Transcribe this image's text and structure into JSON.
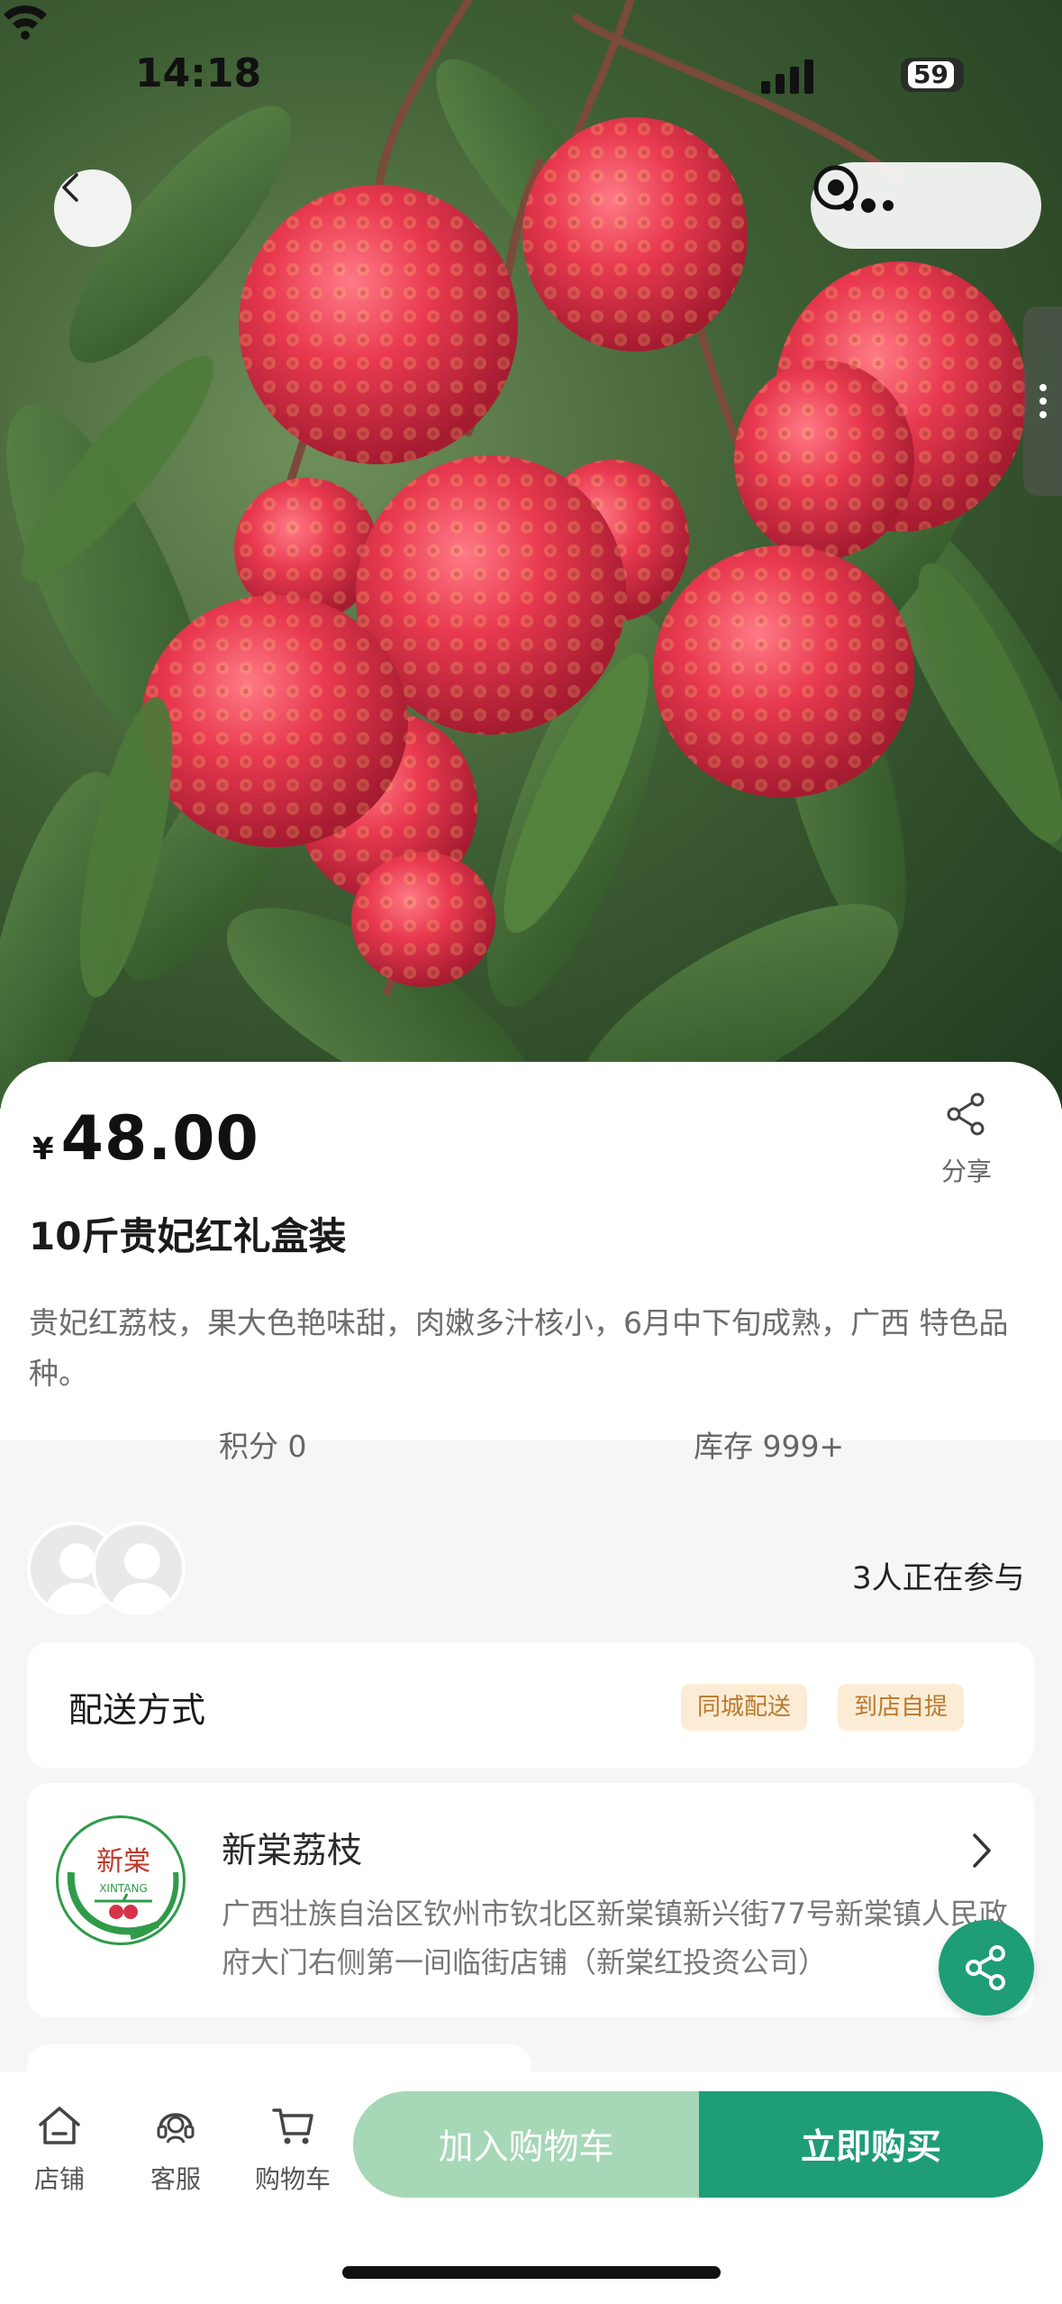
{
  "status_bar": {
    "time": "14:18",
    "battery": "59"
  },
  "product": {
    "currency": "¥",
    "price": "48.00",
    "title": "10斤贵妃红礼盒装",
    "description": "贵妃红荔枝，果大色艳味甜，肉嫩多汁核小，6月中下旬成熟，广西 特色品种。",
    "points_label": "积分 0",
    "stock_label": "库存 999+"
  },
  "share": {
    "label": "分享",
    "icon": "share-icon"
  },
  "participants": {
    "count_label": "3人正在参与"
  },
  "delivery": {
    "label": "配送方式",
    "options": [
      "同城配送",
      "到店自提"
    ]
  },
  "store": {
    "name": "新棠荔枝",
    "address": "广西壮族自治区钦州市钦北区新棠镇新兴街77号新棠镇人民政府大门右侧第一间临街店铺（新棠红投资公司）",
    "logo_text_cn": "新棠",
    "logo_text_en": "XINTANG"
  },
  "bottom_bar": {
    "tabs": [
      {
        "label": "店铺",
        "icon": "store-icon"
      },
      {
        "label": "客服",
        "icon": "customer-service-icon"
      },
      {
        "label": "购物车",
        "icon": "cart-icon"
      }
    ],
    "add_to_cart": "加入购物车",
    "buy_now": "立即购买"
  },
  "colors": {
    "primary": "#1e9d77",
    "primary_light": "#a6d7b6",
    "tag_bg": "#fcecd5",
    "tag_text": "#b8792f",
    "fruit_red": "#e8394f"
  }
}
